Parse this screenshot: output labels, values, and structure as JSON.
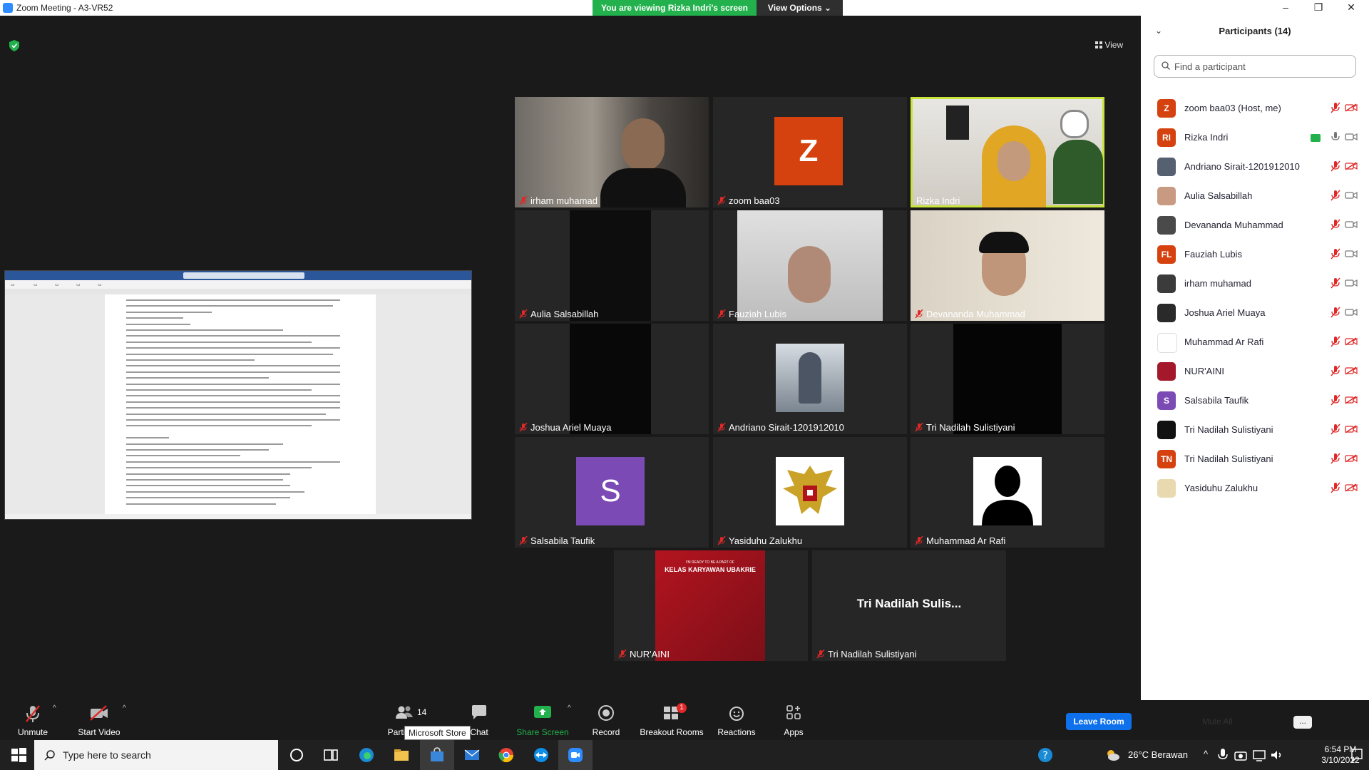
{
  "window": {
    "title": "Zoom Meeting - A3-VR52",
    "minimize": "–",
    "restore": "❐",
    "close": "✕"
  },
  "banner": {
    "viewing": "You are viewing Rizka Indri's screen",
    "view_options": "View Options ⌄"
  },
  "main": {
    "view_label": "View"
  },
  "tiles": [
    {
      "name": "irham muhamad"
    },
    {
      "name": "zoom baa03",
      "initial": "Z",
      "color": "#d5420f"
    },
    {
      "name": "Rizka Indri"
    },
    {
      "name": "Aulia Salsabillah"
    },
    {
      "name": "Fauziah Lubis"
    },
    {
      "name": "Devananda Muhammad"
    },
    {
      "name": "Joshua Ariel Muaya"
    },
    {
      "name": "Andriano Sirait-1201912010"
    },
    {
      "name": "Tri Nadilah Sulistiyani"
    },
    {
      "name": "Salsabila Taufik",
      "initial": "S",
      "color": "#7b4ab5"
    },
    {
      "name": "Yasiduhu Zalukhu"
    },
    {
      "name": "Muhammad Ar Rafi"
    },
    {
      "name": "NUR'AINI",
      "video_text": "I'M READY TO BE A PART OF",
      "video_text2": "KELAS KARYAWAN UBAKRIE"
    },
    {
      "name": "Tri Nadilah Sulistiyani",
      "center_text": "Tri Nadilah Sulis..."
    }
  ],
  "panel": {
    "title": "Participants (14)",
    "search_placeholder": "Find a participant",
    "mute_all": "Mute All",
    "more": "...",
    "participants": [
      {
        "name": "zoom baa03 (Host, me)",
        "initial": "Z",
        "color": "#d5420f"
      },
      {
        "name": "Rizka Indri",
        "initial": "RI",
        "color": "#d5420f"
      },
      {
        "name": "Andriano Sirait-1201912010",
        "initial": "",
        "color": "#556070"
      },
      {
        "name": "Aulia Salsabillah",
        "initial": "",
        "color": "#c99a82"
      },
      {
        "name": "Devananda Muhammad",
        "initial": "",
        "color": "#4a4a4a"
      },
      {
        "name": "Fauziah Lubis",
        "initial": "FL",
        "color": "#d5420f"
      },
      {
        "name": "irham muhamad",
        "initial": "",
        "color": "#3b3b3b"
      },
      {
        "name": "Joshua Ariel Muaya",
        "initial": "",
        "color": "#2a2a2a"
      },
      {
        "name": "Muhammad Ar Rafi",
        "initial": "",
        "color": "#ffffff"
      },
      {
        "name": "NUR'AINI",
        "initial": "",
        "color": "#a3192b"
      },
      {
        "name": "Salsabila Taufik",
        "initial": "S",
        "color": "#7b4ab5"
      },
      {
        "name": "Tri Nadilah Sulistiyani",
        "initial": "",
        "color": "#111111"
      },
      {
        "name": "Tri Nadilah Sulistiyani",
        "initial": "TN",
        "color": "#d5420f"
      },
      {
        "name": "Yasiduhu Zalukhu",
        "initial": "",
        "color": "#e8d9b0"
      }
    ]
  },
  "toolbar": {
    "unmute": "Unmute",
    "start_video": "Start Video",
    "participants": "Participants",
    "participants_count": "14",
    "chat": "Chat",
    "share_screen": "Share Screen",
    "record": "Record",
    "breakout_rooms": "Breakout Rooms",
    "breakout_badge": "1",
    "reactions": "Reactions",
    "apps": "Apps",
    "leave_room": "Leave Room",
    "tooltip": "Microsoft Store"
  },
  "taskbar": {
    "search_placeholder": "Type here to search",
    "weather": "26°C  Berawan",
    "time": "6:54 PM",
    "date": "3/10/2022"
  },
  "colors": {
    "accent": "#0e71eb",
    "green": "#22b14c",
    "active_border": "#c8e33a",
    "avatar_orange": "#d5420f"
  }
}
